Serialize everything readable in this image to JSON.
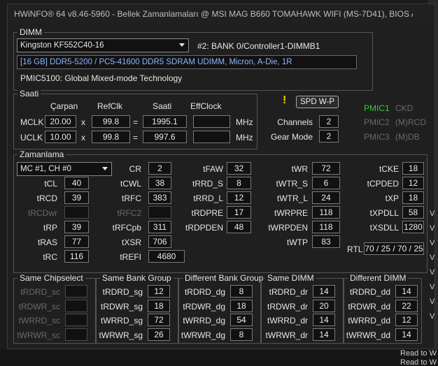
{
  "title": "HWiNFO® 64 v8.46-5960 - Bellek Zamanlamaları @ MSI MAG B660 TOMAHAWK WIFI (MS-7D41), BIOS A.",
  "dimm": {
    "group_title": "DIMM",
    "module_select": "Kingston KF552C40-16",
    "slot": "#2: BANK 0/Controller1-DIMMB1",
    "description": "[16 GB] DDR5-5200 / PC5-41600 DDR5 SDRAM UDIMM, Micron, A-Die, 1R",
    "pmic": "PMIC5100: Global Mixed-mode Technology"
  },
  "saati": {
    "group_title": "Saati",
    "headers": [
      "Çarpan",
      "RefClk",
      "Saati",
      "EffClock"
    ],
    "rows": [
      {
        "label": "MCLK",
        "carpan": "20.00",
        "op1": "x",
        "refclk": "99.8",
        "op2": "=",
        "saati": "1995.1",
        "eff": "",
        "unit": "MHz"
      },
      {
        "label": "UCLK",
        "carpan": "10.00",
        "op1": "x",
        "refclk": "99.8",
        "op2": "=",
        "saati": "997.6",
        "eff": "",
        "unit": "MHz"
      }
    ]
  },
  "spd": {
    "button": "SPD W-P",
    "warning": "!",
    "channels_label": "Channels",
    "channels": "2",
    "gear_label": "Gear Mode",
    "gear": "2",
    "pmic": [
      {
        "name": "PMIC1",
        "rail": "CKD"
      },
      {
        "name": "PMIC2",
        "rail": "(M)RCD"
      },
      {
        "name": "PMIC3",
        "rail": "(M)DB"
      }
    ]
  },
  "zamanlama": {
    "group_title": "Zamanlama",
    "mc_select": "MC #1, CH #0",
    "col1": [
      {
        "label": "tCL",
        "value": "40"
      },
      {
        "label": "tRCD",
        "value": "39"
      },
      {
        "label": "tRCDwr",
        "value": ""
      },
      {
        "label": "tRP",
        "value": "39"
      },
      {
        "label": "tRAS",
        "value": "77"
      },
      {
        "label": "tRC",
        "value": "116"
      }
    ],
    "col2": [
      {
        "label": "CR",
        "value": "2"
      },
      {
        "label": "tCWL",
        "value": "38"
      },
      {
        "label": "tRFC",
        "value": "383"
      },
      {
        "label": "tRFC2",
        "value": ""
      },
      {
        "label": "tRFCpb",
        "value": "311"
      },
      {
        "label": "tXSR",
        "value": "706"
      },
      {
        "label": "tREFI",
        "value": "4680"
      }
    ],
    "col3": [
      {
        "label": "tFAW",
        "value": "32"
      },
      {
        "label": "tRRD_S",
        "value": "8"
      },
      {
        "label": "tRRD_L",
        "value": "12"
      },
      {
        "label": "tRDPRE",
        "value": "17"
      },
      {
        "label": "tRDPDEN",
        "value": "48"
      }
    ],
    "col4": [
      {
        "label": "tWR",
        "value": "72"
      },
      {
        "label": "tWTR_S",
        "value": "6"
      },
      {
        "label": "tWTR_L",
        "value": "24"
      },
      {
        "label": "tWRPRE",
        "value": "118"
      },
      {
        "label": "tWRPDEN",
        "value": "118"
      },
      {
        "label": "tWTP",
        "value": "83"
      }
    ],
    "col5": [
      {
        "label": "tCKE",
        "value": "18"
      },
      {
        "label": "tCPDED",
        "value": "12"
      },
      {
        "label": "tXP",
        "value": "18"
      },
      {
        "label": "tXPDLL",
        "value": "58"
      },
      {
        "label": "tXSDLL",
        "value": "1280"
      }
    ],
    "rtl_label": "RTL",
    "rtl": "70 / 25 / 70 / 25"
  },
  "groups": [
    {
      "title": "Same Chipselect",
      "rows": [
        {
          "label": "tRDRD_sc",
          "value": ""
        },
        {
          "label": "tRDWR_sc",
          "value": ""
        },
        {
          "label": "tWRRD_sc",
          "value": ""
        },
        {
          "label": "tWRWR_sc",
          "value": ""
        }
      ]
    },
    {
      "title": "Same Bank Group",
      "rows": [
        {
          "label": "tRDRD_sg",
          "value": "12"
        },
        {
          "label": "tRDWR_sg",
          "value": "18"
        },
        {
          "label": "tWRRD_sg",
          "value": "72"
        },
        {
          "label": "tWRWR_sg",
          "value": "26"
        }
      ]
    },
    {
      "title": "Different Bank Group",
      "rows": [
        {
          "label": "tRDRD_dg",
          "value": "8"
        },
        {
          "label": "tRDWR_dg",
          "value": "18"
        },
        {
          "label": "tWRRD_dg",
          "value": "54"
        },
        {
          "label": "tWRWR_dg",
          "value": "8"
        }
      ]
    },
    {
      "title": "Same DIMM",
      "rows": [
        {
          "label": "tRDRD_dr",
          "value": "14"
        },
        {
          "label": "tRDWR_dr",
          "value": "20"
        },
        {
          "label": "tWRRD_dr",
          "value": "14"
        },
        {
          "label": "tWRWR_dr",
          "value": "14"
        }
      ]
    },
    {
      "title": "Different DIMM",
      "rows": [
        {
          "label": "tRDRD_dd",
          "value": "14"
        },
        {
          "label": "tRDWR_dd",
          "value": "22"
        },
        {
          "label": "tWRRD_dd",
          "value": "12"
        },
        {
          "label": "tWRWR_dd",
          "value": "14"
        }
      ]
    }
  ],
  "background": {
    "side_glyphs": [
      "V",
      "V",
      "V",
      "V",
      "V",
      "V",
      "V",
      "V"
    ],
    "bottom_lines": [
      "Read to W",
      "Read to W"
    ]
  }
}
